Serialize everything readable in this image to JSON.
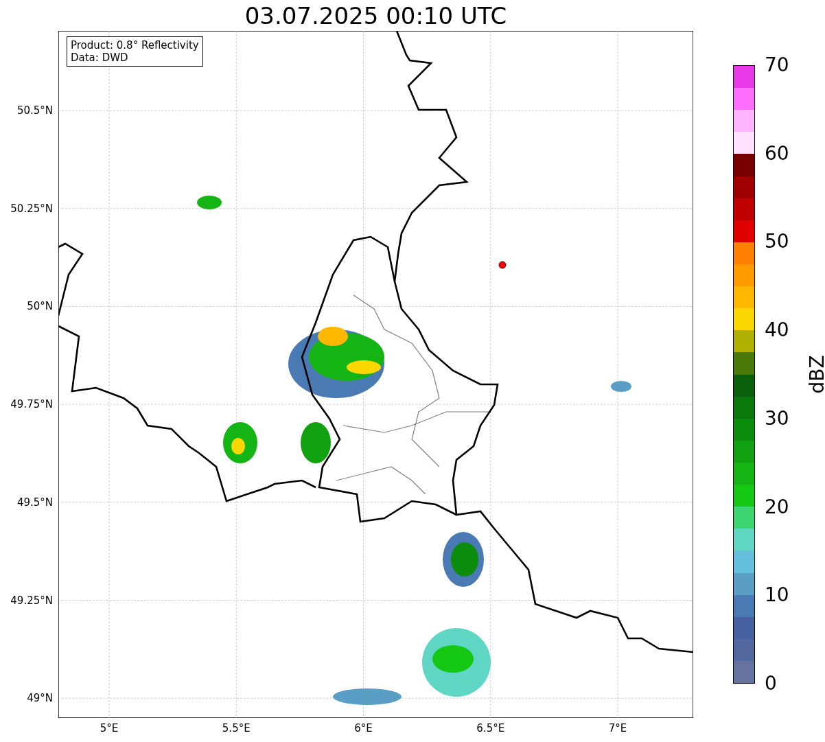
{
  "title": "03.07.2025 00:10 UTC",
  "legend": [
    "Product: 0.8° Reflectivity",
    "Data: DWD"
  ],
  "lat_labels": [
    "50.5°N",
    "50.25°N",
    "50°N",
    "49.75°N",
    "49.5°N",
    "49.25°N",
    "49°N"
  ],
  "lon_labels": [
    "5°E",
    "5.5°E",
    "6°E",
    "6.5°E",
    "7°E"
  ],
  "colorbar": {
    "label": "dBZ",
    "ticks": [
      "70",
      "60",
      "50",
      "40",
      "30",
      "20",
      "10",
      "0"
    ],
    "bins": [
      {
        "color": "#e838e8"
      },
      {
        "color": "#ff6eff"
      },
      {
        "color": "#ffb4ff"
      },
      {
        "color": "#ffe0ff"
      },
      {
        "color": "#780000"
      },
      {
        "color": "#a00000"
      },
      {
        "color": "#c00000"
      },
      {
        "color": "#e00000"
      },
      {
        "color": "#ff8000"
      },
      {
        "color": "#ff9a00"
      },
      {
        "color": "#ffb800"
      },
      {
        "color": "#ffd700"
      },
      {
        "color": "#b0b000"
      },
      {
        "color": "#4a7a0a"
      },
      {
        "color": "#0a5f0a"
      },
      {
        "color": "#0a780a"
      },
      {
        "color": "#0c8c0c"
      },
      {
        "color": "#10a010"
      },
      {
        "color": "#14b414"
      },
      {
        "color": "#14c814"
      },
      {
        "color": "#3dd572"
      },
      {
        "color": "#5fd7c4"
      },
      {
        "color": "#64c0dc"
      },
      {
        "color": "#5a9ec6"
      },
      {
        "color": "#4a7ab3"
      },
      {
        "color": "#4660a0"
      },
      {
        "color": "#5468a0"
      },
      {
        "color": "#66739f"
      }
    ]
  }
}
